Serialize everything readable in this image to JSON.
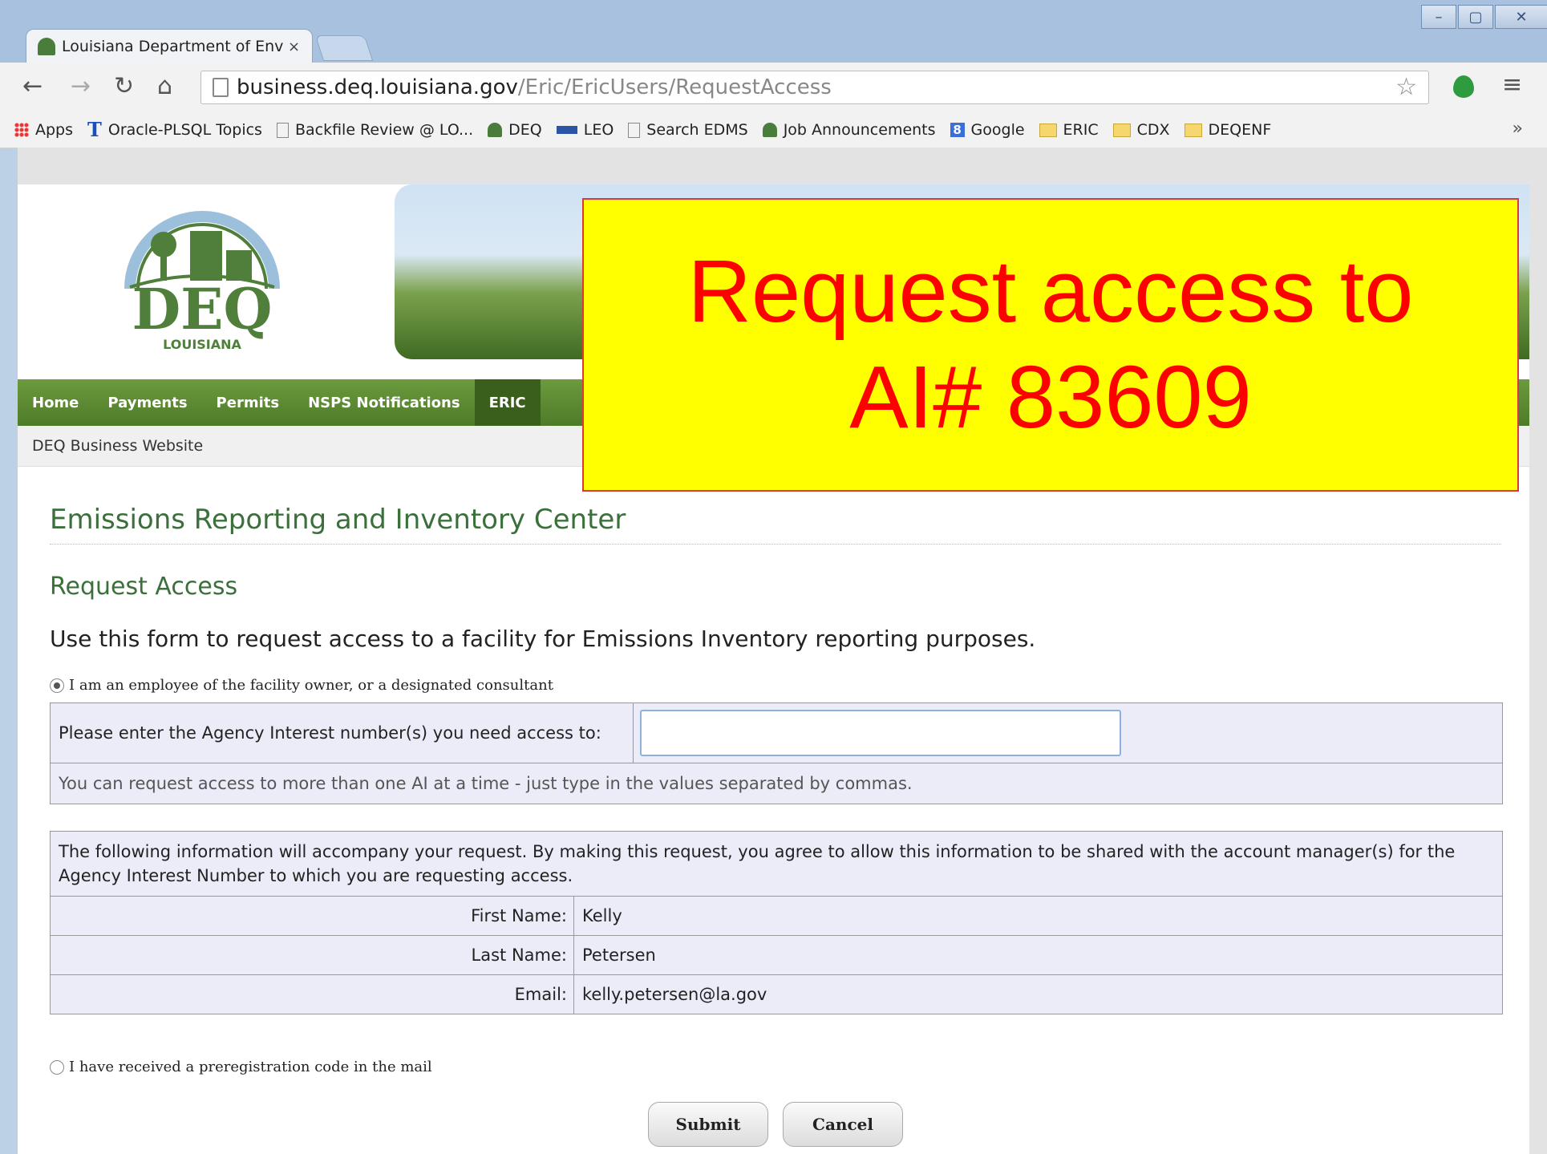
{
  "browser": {
    "tab_title": "Louisiana Department of Env",
    "tab_close": "×",
    "url_host": "business.deq.louisiana.gov",
    "url_path": "/Eric/EricUsers/RequestAccess",
    "bookmarks": [
      "Apps",
      "Oracle-PLSQL Topics",
      "Backfile Review @ LO...",
      "DEQ",
      "LEO",
      "Search EDMS",
      "Job Announcements",
      "Google",
      "ERIC",
      "CDX",
      "DEQENF"
    ],
    "bookmarks_more": "»"
  },
  "site": {
    "logo_text": "DEQ",
    "logo_sub": "LOUISIANA",
    "nav": [
      "Home",
      "Payments",
      "Permits",
      "NSPS Notifications",
      "ERIC"
    ],
    "subbar": "DEQ Business Website"
  },
  "page": {
    "title": "Emissions Reporting and Inventory Center",
    "subtitle": "Request Access",
    "intro": "Use this form to request access to a facility for Emissions Inventory reporting purposes.",
    "option1": "I am an employee of the facility owner, or a designated consultant",
    "ai_label": "Please enter the Agency Interest number(s) you need access to:",
    "ai_value": "",
    "ai_hint": "You can request access to more than one AI at a time - just type in the values separated by commas.",
    "info_note": "The following information will accompany your request. By making this request, you agree to allow this information to be shared with the account manager(s) for the Agency Interest Number to which you are requesting access.",
    "fields": [
      {
        "label": "First Name:",
        "value": "Kelly"
      },
      {
        "label": "Last Name:",
        "value": "Petersen"
      },
      {
        "label": "Email:",
        "value": "kelly.petersen@la.gov"
      }
    ],
    "option2": "I have received a preregistration code in the mail",
    "submit": "Submit",
    "cancel": "Cancel"
  },
  "callout": {
    "line1": "Request access to",
    "line2": "AI# 83609"
  }
}
